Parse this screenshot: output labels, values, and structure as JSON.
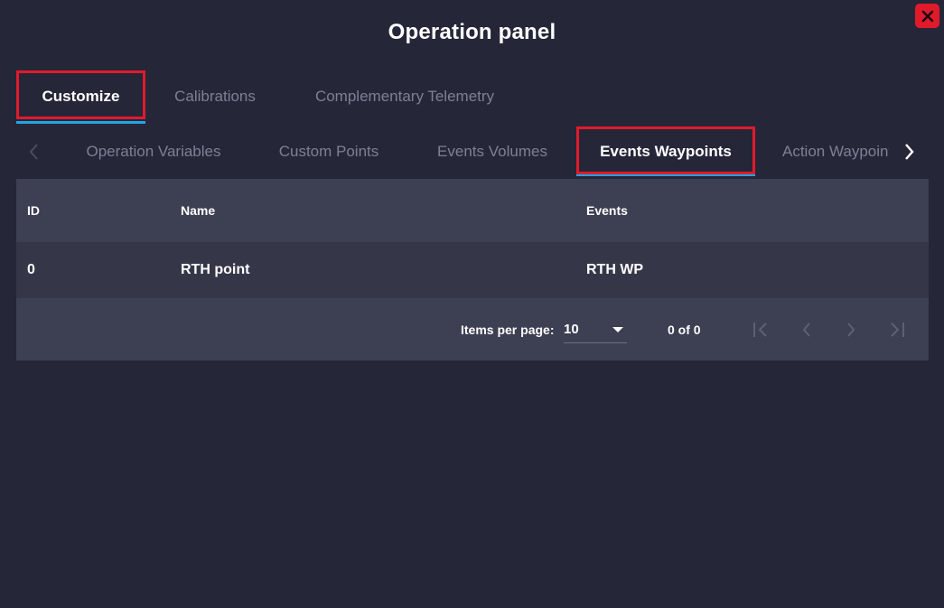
{
  "panel": {
    "title": "Operation panel",
    "close_icon": "close-icon"
  },
  "main_tabs": [
    {
      "label": "Customize",
      "active": true
    },
    {
      "label": "Calibrations",
      "active": false
    },
    {
      "label": "Complementary Telemetry",
      "active": false
    }
  ],
  "sub_tabs": [
    {
      "label": "Operation Variables",
      "active": false
    },
    {
      "label": "Custom Points",
      "active": false
    },
    {
      "label": "Events Volumes",
      "active": false
    },
    {
      "label": "Events Waypoints",
      "active": true
    },
    {
      "label": "Action Waypoints",
      "active": false
    }
  ],
  "table": {
    "columns": [
      "ID",
      "Name",
      "Events"
    ],
    "rows": [
      {
        "id": "0",
        "name": "RTH point",
        "events": "RTH WP"
      }
    ]
  },
  "paginator": {
    "items_per_page_label": "Items per page:",
    "items_per_page_value": "10",
    "range_label": "0 of 0"
  },
  "colors": {
    "background": "#252739",
    "accent": "#1fa5e6",
    "highlight": "#e11a2b"
  }
}
